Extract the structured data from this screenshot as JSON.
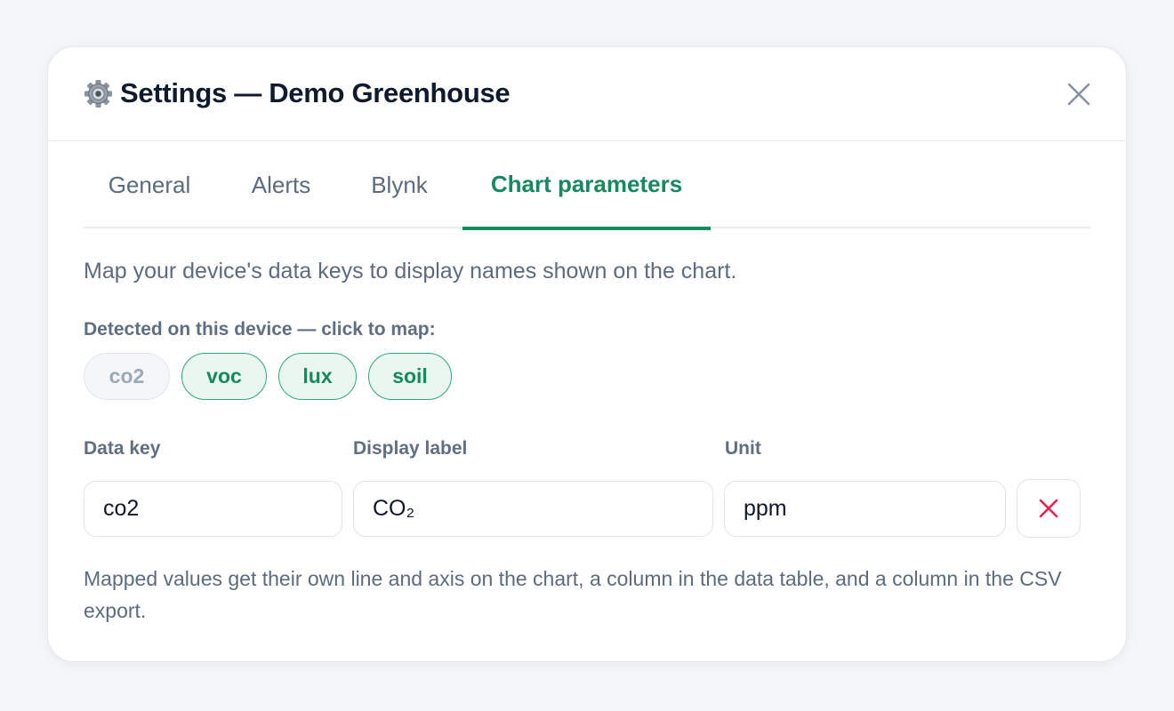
{
  "modal": {
    "title": "Settings — Demo Greenhouse",
    "title_icon": "gear-icon",
    "close_icon": "close-icon"
  },
  "tabs": [
    {
      "label": "General",
      "active": false
    },
    {
      "label": "Alerts",
      "active": false
    },
    {
      "label": "Blynk",
      "active": false
    },
    {
      "label": "Chart parameters",
      "active": true
    }
  ],
  "chart_params": {
    "description": "Map your device's data keys to display names shown on the chart.",
    "detected_label": "Detected on this device — click to map:",
    "chips": [
      {
        "label": "co2",
        "mapped": true
      },
      {
        "label": "voc",
        "mapped": false
      },
      {
        "label": "lux",
        "mapped": false
      },
      {
        "label": "soil",
        "mapped": false
      }
    ],
    "columns": {
      "data_key": "Data key",
      "display_label": "Display label",
      "unit": "Unit"
    },
    "rows": [
      {
        "data_key": "co2",
        "display_label": "CO₂",
        "unit": "ppm"
      }
    ],
    "note": "Mapped values get their own line and axis on the chart, a column in the data table, and a column in the CSV export."
  },
  "colors": {
    "accent": "#16895e",
    "danger": "#e0244f",
    "text_muted": "#5c6b7e",
    "title": "#0f1b2d"
  }
}
